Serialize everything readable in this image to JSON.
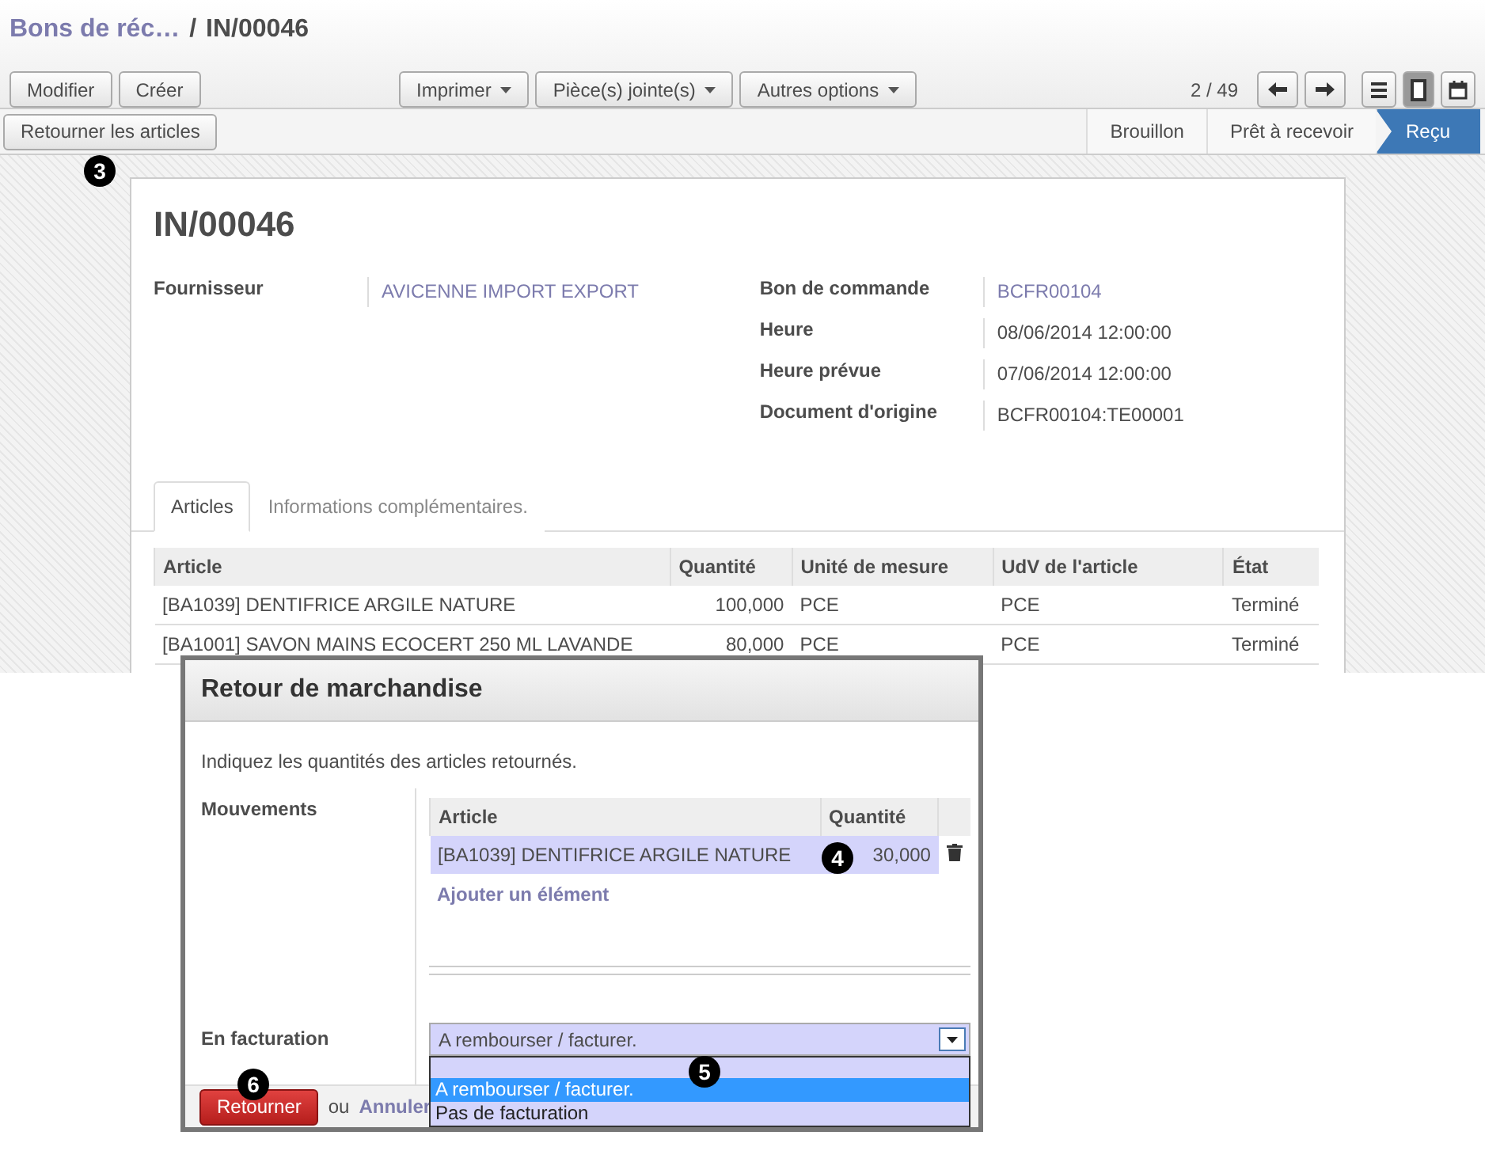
{
  "breadcrumb": {
    "parent": "Bons de réc…",
    "separator": "/",
    "current": "IN/00046"
  },
  "toolbar": {
    "left_buttons": [
      "Modifier",
      "Créer"
    ],
    "menus": [
      "Imprimer",
      "Pièce(s) jointe(s)",
      "Autres options"
    ],
    "pager": "2 / 49",
    "views": [
      {
        "kind": "list",
        "selected": false
      },
      {
        "kind": "form",
        "selected": true
      },
      {
        "kind": "calendar",
        "selected": false
      }
    ]
  },
  "action_button": {
    "label": "Retourner les articles",
    "callout": "3"
  },
  "stages": [
    {
      "label": "Brouillon",
      "selected": false
    },
    {
      "label": "Prêt à recevoir",
      "selected": false
    },
    {
      "label": "Reçu",
      "selected": true
    }
  ],
  "record": {
    "title": "IN/00046",
    "left_fields": [
      {
        "label": "Fournisseur",
        "value": "AVICENNE IMPORT EXPORT",
        "link": true
      }
    ],
    "right_fields": [
      {
        "label": "Bon de commande",
        "value": "BCFR00104",
        "link": true
      },
      {
        "label": "Heure",
        "value": "08/06/2014 12:00:00",
        "link": false
      },
      {
        "label": "Heure prévue",
        "value": "07/06/2014 12:00:00",
        "link": false
      },
      {
        "label": "Document d'origine",
        "value": "BCFR00104:TE00001",
        "link": false
      }
    ]
  },
  "tabs": [
    {
      "label": "Articles",
      "selected": true
    },
    {
      "label": "Informations complémentaires.",
      "selected": false
    }
  ],
  "table": {
    "columns": [
      "Article",
      "Quantité",
      "Unité de mesure",
      "UdV de l'article",
      "État"
    ],
    "rows": [
      [
        "[BA1039] DENTIFRICE ARGILE NATURE",
        "100,000",
        "PCE",
        "PCE",
        "Terminé"
      ],
      [
        "[BA1001] SAVON MAINS ECOCERT 250 ML LAVANDE",
        "80,000",
        "PCE",
        "PCE",
        "Terminé"
      ]
    ]
  },
  "dialog": {
    "title": "Retour de marchandise",
    "instruction": "Indiquez les quantités des articles retournés.",
    "moves_label": "Mouvements",
    "moves_columns": [
      "Article",
      "Quantité"
    ],
    "moves_rows": [
      {
        "article": "[BA1039] DENTIFRICE ARGILE NATURE",
        "quantity": "30,000",
        "selected": true,
        "callout": "4"
      }
    ],
    "add_link": "Ajouter un élément",
    "invoice_label": "En facturation",
    "invoice_select": {
      "value": "A rembourser / facturer.",
      "expanded": true,
      "callout": "5",
      "options": [
        {
          "label": "A rembourser / facturer.",
          "selected": true
        },
        {
          "label": "Pas de facturation",
          "selected": false
        }
      ]
    },
    "confirm_button": {
      "label": "Retourner",
      "callout": "6"
    },
    "or_text": "ou",
    "cancel_link": "Annuler"
  }
}
